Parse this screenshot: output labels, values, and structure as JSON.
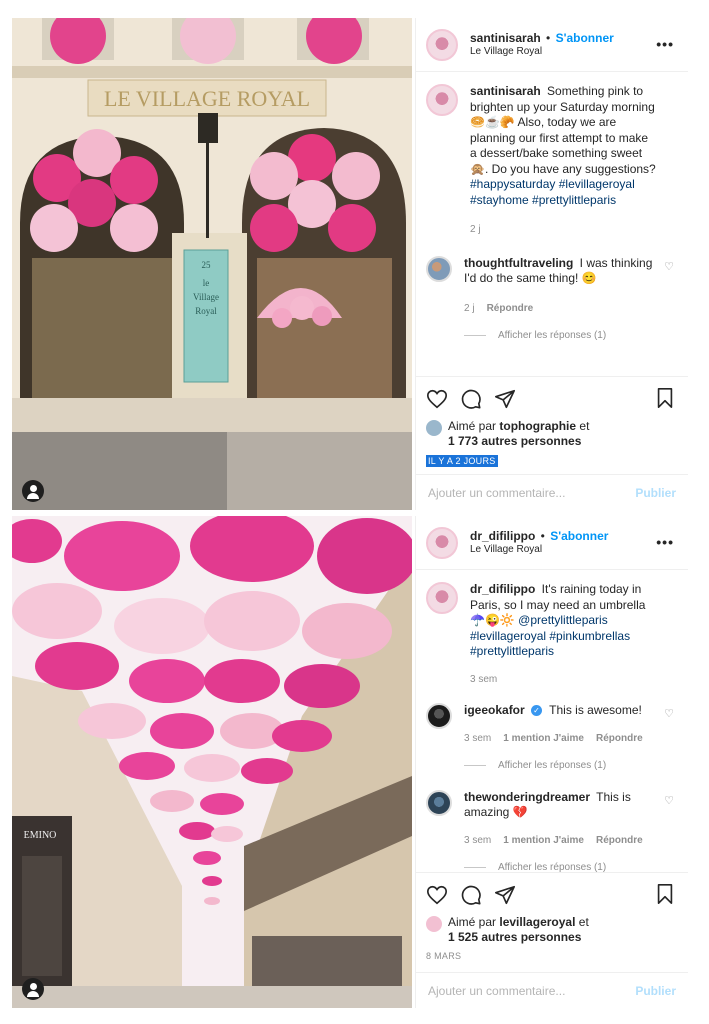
{
  "posts": [
    {
      "username": "santinisarah",
      "follow_label": "S'abonner",
      "separator": "•",
      "location": "Le Village Royal",
      "caption": {
        "username": "santinisarah",
        "text": "Something pink to brighten up your Saturday morning 🥯☕🥐 Also, today we are planning our first attempt to make a dessert/bake something sweet 🙊. Do you have any suggestions?",
        "hashtags": "#happysaturday #levillageroyal #stayhome #prettylittleparis",
        "time": "2 j"
      },
      "comments": [
        {
          "username": "thoughtfultraveling",
          "text": "I was thinking I'd do the same thing! 😊",
          "time": "2 j",
          "reply_label": "Répondre",
          "view_replies": "Afficher les réponses (1)"
        }
      ],
      "liked_by_prefix": "Aimé par",
      "liked_by_user": "tophographie",
      "liked_by_conj": "et",
      "liked_by_others": "1 773 autres personnes",
      "timestamp": "IL Y A 2 JOURS",
      "comment_placeholder": "Ajouter un commentaire...",
      "publish_label": "Publier",
      "photo_sign": {
        "line1": "LE VILLAGE ROYAL",
        "line2": "25",
        "line3": "le",
        "line4": "Village",
        "line5": "Royal"
      }
    },
    {
      "username": "dr_difilippo",
      "follow_label": "S'abonner",
      "separator": "•",
      "location": "Le Village Royal",
      "caption": {
        "username": "dr_difilippo",
        "text": "It's raining today in Paris, so I may need an umbrella ☂️😜🔆",
        "hashtags": "@prettylittleparis #levillageroyal #pinkumbrellas #prettylittleparis",
        "time": "3 sem"
      },
      "comments": [
        {
          "username": "igeeokafor",
          "verified": "✓",
          "text": "This is awesome!",
          "time": "3 sem",
          "likes_label": "1 mention J'aime",
          "reply_label": "Répondre",
          "view_replies": "Afficher les réponses (1)"
        },
        {
          "username": "thewonderingdreamer",
          "text": "This is amazing 💔",
          "time": "3 sem",
          "likes_label": "1 mention J'aime",
          "reply_label": "Répondre",
          "view_replies": "Afficher les réponses (1)"
        }
      ],
      "liked_by_prefix": "Aimé par",
      "liked_by_user": "levillageroyal",
      "liked_by_conj": "et",
      "liked_by_others": "1 525 autres personnes",
      "timestamp": "8 MARS",
      "comment_placeholder": "Ajouter un commentaire...",
      "publish_label": "Publier",
      "photo_sign": {
        "line1": "EMINO"
      }
    }
  ],
  "icons": {
    "more": "more-options-icon",
    "like": "heart-icon",
    "comment": "comment-icon",
    "share": "share-icon",
    "save": "bookmark-icon",
    "tag": "user-tag-icon"
  },
  "colors": {
    "follow": "#0095f6",
    "hashtag": "#00376b",
    "muted": "#8e8e8e",
    "publish_disabled": "#b2dffc",
    "selection": "#1a73d9",
    "umbrella_pink": "#e8388a",
    "umbrella_light": "#f6c6d8"
  }
}
